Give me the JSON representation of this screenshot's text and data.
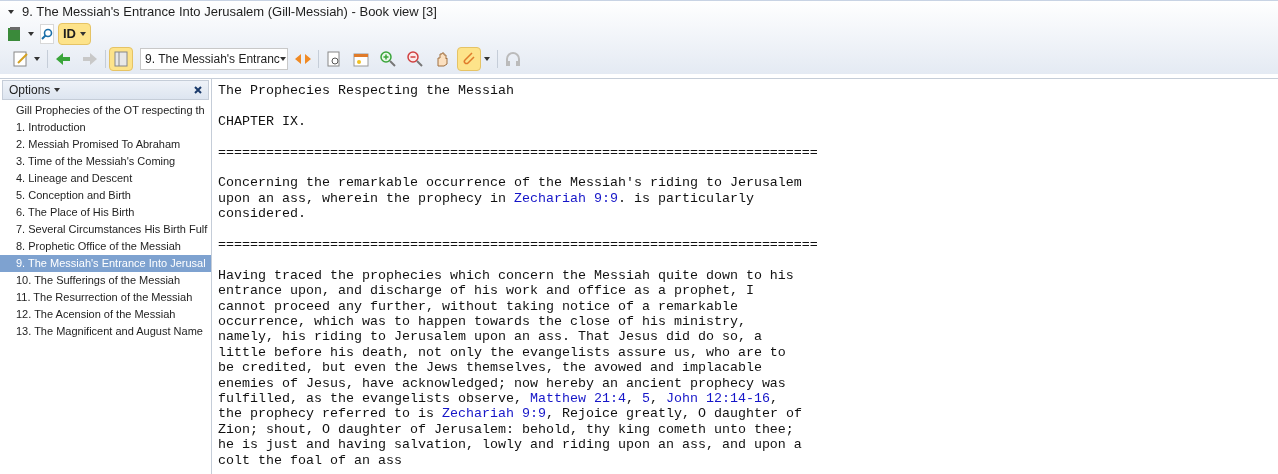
{
  "window": {
    "title": "9. The Messiah's Entrance Into Jerusalem (Gill-Messiah) - Book view [3]"
  },
  "toolbar_top": {
    "id_button": "ID"
  },
  "toolbar": {
    "chapter_select": "9. The Messiah's Entranc"
  },
  "sidebar": {
    "header": "Options",
    "items": [
      {
        "label": "Gill Prophecies of the OT respecting th",
        "selected": false
      },
      {
        "label": "1. Introduction",
        "selected": false
      },
      {
        "label": "2. Messiah Promised To Abraham",
        "selected": false
      },
      {
        "label": "3. Time of the Messiah's Coming",
        "selected": false
      },
      {
        "label": "4. Lineage and Descent",
        "selected": false
      },
      {
        "label": "5. Conception and Birth",
        "selected": false
      },
      {
        "label": "6. The Place of His Birth",
        "selected": false
      },
      {
        "label": "7. Several Circumstances His Birth Fulf",
        "selected": false
      },
      {
        "label": "8. Prophetic Office of the Messiah",
        "selected": false
      },
      {
        "label": "9. The Messiah's Entrance Into Jerusal",
        "selected": true
      },
      {
        "label": "10. The Sufferings of the Messiah",
        "selected": false
      },
      {
        "label": "11. The Resurrection of the Messiah",
        "selected": false
      },
      {
        "label": "12. The Acension of the Messiah",
        "selected": false
      },
      {
        "label": "13. The Magnificent and August Name",
        "selected": false
      }
    ]
  },
  "document": [
    {
      "lines": [
        [
          {
            "kind": "text",
            "text": "The Prophecies Respecting the Messiah"
          }
        ]
      ]
    },
    {
      "lines": [
        [
          {
            "kind": "text",
            "text": "CHAPTER IX."
          }
        ]
      ]
    },
    {
      "lines": [
        [
          {
            "kind": "text",
            "text": "==========================================================================="
          }
        ]
      ]
    },
    {
      "lines": [
        [
          {
            "kind": "text",
            "text": "Concerning the remarkable occurrence of the Messiah's riding to Jerusalem"
          }
        ],
        [
          {
            "kind": "text",
            "text": "upon an ass, wherein the prophecy in "
          },
          {
            "kind": "link",
            "text": "Zechariah 9:9"
          },
          {
            "kind": "text",
            "text": ". is particularly"
          }
        ],
        [
          {
            "kind": "text",
            "text": "considered."
          }
        ]
      ]
    },
    {
      "lines": [
        [
          {
            "kind": "text",
            "text": "==========================================================================="
          }
        ]
      ]
    },
    {
      "lines": [
        [
          {
            "kind": "text",
            "text": "Having traced the prophecies which concern the Messiah quite down to his"
          }
        ],
        [
          {
            "kind": "text",
            "text": "entrance upon, and discharge of his work and office as a prophet, I"
          }
        ],
        [
          {
            "kind": "text",
            "text": "cannot proceed any further, without taking notice of a remarkable"
          }
        ],
        [
          {
            "kind": "text",
            "text": "occurrence, which was to happen towards the close of his ministry,"
          }
        ],
        [
          {
            "kind": "text",
            "text": "namely, his riding to Jerusalem upon an ass. That Jesus did do so, a"
          }
        ],
        [
          {
            "kind": "text",
            "text": "little before his death, not only the evangelists assure us, who are to"
          }
        ],
        [
          {
            "kind": "text",
            "text": "be credited, but even the Jews themselves, the avowed and implacable"
          }
        ],
        [
          {
            "kind": "text",
            "text": "enemies of Jesus, have acknowledged; now hereby an ancient prophecy was"
          }
        ],
        [
          {
            "kind": "text",
            "text": "fulfilled, as the evangelists observe, "
          },
          {
            "kind": "link",
            "text": "Matthew 21:4"
          },
          {
            "kind": "text",
            "text": ", "
          },
          {
            "kind": "link",
            "text": "5"
          },
          {
            "kind": "text",
            "text": ", "
          },
          {
            "kind": "link",
            "text": "John 12:14-16"
          },
          {
            "kind": "text",
            "text": ","
          }
        ],
        [
          {
            "kind": "text",
            "text": "the prophecy referred to is "
          },
          {
            "kind": "link",
            "text": "Zechariah 9:9"
          },
          {
            "kind": "text",
            "text": ", Rejoice greatly, O daughter of"
          }
        ],
        [
          {
            "kind": "text",
            "text": "Zion; shout, O daughter of Jerusalem: behold, thy king cometh unto thee;"
          }
        ],
        [
          {
            "kind": "text",
            "text": "he is just and having salvation, lowly and riding upon an ass, and upon a"
          }
        ],
        [
          {
            "kind": "text",
            "text": "colt the foal of an ass"
          }
        ]
      ]
    }
  ]
}
